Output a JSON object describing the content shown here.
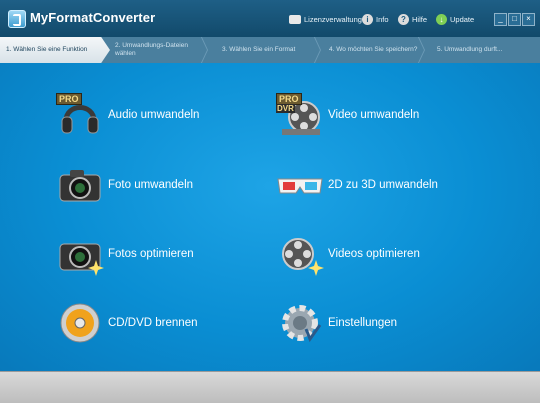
{
  "app": {
    "title": "MyFormatConverter"
  },
  "toolbar": [
    {
      "label": "Lizenzverwaltung",
      "icon": "license-card-icon"
    },
    {
      "label": "Info",
      "icon": "info-icon"
    },
    {
      "label": "Hilfe",
      "icon": "help-icon"
    },
    {
      "label": "Update",
      "icon": "update-icon"
    }
  ],
  "window_controls": {
    "minimize": "_",
    "maximize": "□",
    "close": "×"
  },
  "steps": [
    "1. Wählen Sie eine Funktion",
    "2. Umwandlungs-Dateien wählen",
    "3. Wählen Sie ein Format",
    "4. Wo möchten Sie speichern?",
    "5. Umwandlung durft..."
  ],
  "functions": [
    {
      "label": "Audio umwandeln",
      "icon": "headphones-pro-icon",
      "badge": "PRO"
    },
    {
      "label": "Video umwandeln",
      "icon": "film-reel-dvr-icon",
      "badge": "PRO",
      "badge2": "DVR"
    },
    {
      "label": "Foto umwandeln",
      "icon": "camera-icon"
    },
    {
      "label": "2D zu 3D umwandeln",
      "icon": "3d-glasses-icon"
    },
    {
      "label": "Fotos optimieren",
      "icon": "camera-sparkle-icon"
    },
    {
      "label": "Videos optimieren",
      "icon": "film-reel-sparkle-icon"
    },
    {
      "label": "CD/DVD brennen",
      "icon": "disc-burn-icon"
    },
    {
      "label": "Einstellungen",
      "icon": "settings-gear-icon"
    }
  ]
}
